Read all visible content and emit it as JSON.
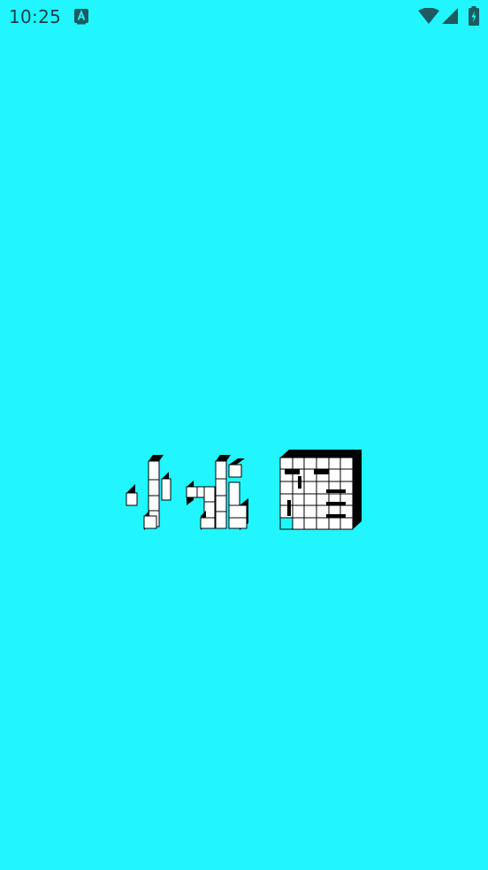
{
  "status_bar": {
    "time": "10:25",
    "icons": [
      "accessibility-a-icon",
      "wifi-icon",
      "cell-signal-icon",
      "battery-charging-icon"
    ]
  },
  "splash": {
    "background_color": "#21f6ff",
    "logo_text": "小水箱",
    "logo_style": "pixel-3d-blocks"
  }
}
